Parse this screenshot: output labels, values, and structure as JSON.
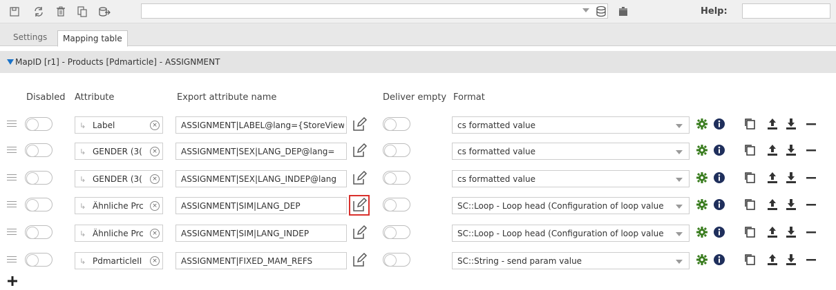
{
  "toolbar": {
    "icons": [
      "save-icon",
      "refresh-icon",
      "delete-icon",
      "copy-icon",
      "export-icon",
      "database-icon",
      "toolbox-icon"
    ],
    "main_input_value": "",
    "help_label": "Help:",
    "help_input_value": ""
  },
  "tabs": [
    {
      "label": "Settings",
      "active": false
    },
    {
      "label": "Mapping table",
      "active": true
    }
  ],
  "section": {
    "title": "MapID [r1] - Products [Pdmarticle] - ASSIGNMENT",
    "expanded": true
  },
  "columns": {
    "disabled": "Disabled",
    "attribute": "Attribute",
    "export_attribute_name": "Export attribute name",
    "deliver_empty": "Deliver empty",
    "format": "Format"
  },
  "rows": [
    {
      "attribute": "Label",
      "export_name": "ASSIGNMENT|LABEL@lang={StoreView",
      "format": "cs formatted value",
      "disabled": false,
      "deliver_empty": false,
      "edit_highlighted": false
    },
    {
      "attribute": "GENDER (3(",
      "export_name": "ASSIGNMENT|SEX|LANG_DEP@lang=",
      "format": "cs formatted value",
      "disabled": false,
      "deliver_empty": false,
      "edit_highlighted": false
    },
    {
      "attribute": "GENDER (3(",
      "export_name": "ASSIGNMENT|SEX|LANG_INDEP@lang",
      "format": "cs formatted value",
      "disabled": false,
      "deliver_empty": false,
      "edit_highlighted": false
    },
    {
      "attribute": "Ähnliche Prc",
      "export_name": "ASSIGNMENT|SIM|LANG_DEP",
      "format": "SC::Loop - Loop head (Configuration of loop value",
      "disabled": false,
      "deliver_empty": false,
      "edit_highlighted": true
    },
    {
      "attribute": "Ähnliche Prc",
      "export_name": "ASSIGNMENT|SIM|LANG_INDEP",
      "format": "SC::Loop - Loop head (Configuration of loop value",
      "disabled": false,
      "deliver_empty": false,
      "edit_highlighted": false
    },
    {
      "attribute": "PdmarticleII",
      "export_name": "ASSIGNMENT|FIXED_MAM_REFS",
      "format": "SC::String - send param value",
      "disabled": false,
      "deliver_empty": false,
      "edit_highlighted": false
    }
  ],
  "row_icons": [
    "gear-icon",
    "info-icon",
    "duplicate-icon",
    "upload-icon",
    "download-icon",
    "remove-icon"
  ],
  "colors": {
    "accent_blue": "#1a73c9",
    "gear_green": "#3a7d1f",
    "info_navy": "#1f2f5c",
    "highlight_red": "#d9302c"
  },
  "add_button": "add-icon"
}
